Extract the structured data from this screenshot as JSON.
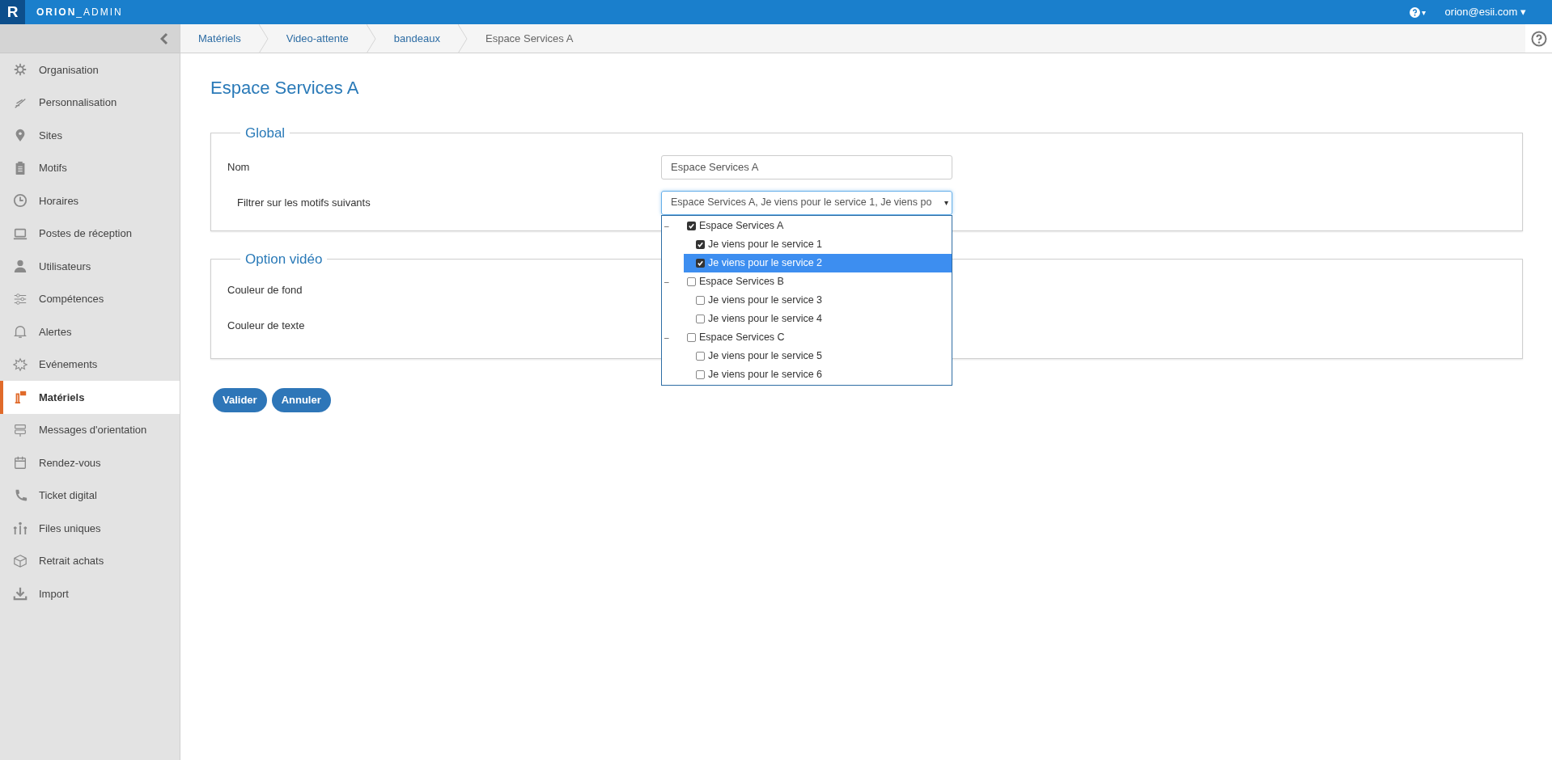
{
  "topbar": {
    "logo": "R",
    "app_name_bold": "ORION",
    "app_name_light": "_ADMIN",
    "help_caret": "▾",
    "user": "orion@esii.com",
    "user_caret": "▾"
  },
  "breadcrumb": [
    "Matériels",
    "Video-attente",
    "bandeaux",
    "Espace Services A"
  ],
  "sidebar": {
    "items": [
      {
        "label": "Organisation",
        "selected": false
      },
      {
        "label": "Personnalisation",
        "selected": false
      },
      {
        "label": "Sites",
        "selected": false
      },
      {
        "label": "Motifs",
        "selected": false
      },
      {
        "label": "Horaires",
        "selected": false
      },
      {
        "label": "Postes de réception",
        "selected": false
      },
      {
        "label": "Utilisateurs",
        "selected": false
      },
      {
        "label": "Compétences",
        "selected": false
      },
      {
        "label": "Alertes",
        "selected": false
      },
      {
        "label": "Evénements",
        "selected": false
      },
      {
        "label": "Matériels",
        "selected": true
      },
      {
        "label": "Messages d'orientation",
        "selected": false
      },
      {
        "label": "Rendez-vous",
        "selected": false
      },
      {
        "label": "Ticket digital",
        "selected": false
      },
      {
        "label": "Files uniques",
        "selected": false
      },
      {
        "label": "Retrait achats",
        "selected": false
      },
      {
        "label": "Import",
        "selected": false
      }
    ]
  },
  "page_title": "Espace Services A",
  "global": {
    "legend": "Global",
    "name_label": "Nom",
    "name_value": "Espace Services A",
    "filter_label": "Filtrer sur les motifs suivants",
    "filter_value": "Espace Services A, Je viens pour le service 1, Je viens po",
    "filter_caret": "▾",
    "tree": [
      {
        "label": "Espace Services A",
        "toggle": "–",
        "checked": true,
        "selected": false,
        "children": [
          {
            "label": "Je viens pour le service 1",
            "checked": true,
            "selected": false
          },
          {
            "label": "Je viens pour le service 2",
            "checked": true,
            "selected": true
          }
        ]
      },
      {
        "label": "Espace Services B",
        "toggle": "–",
        "checked": false,
        "selected": false,
        "children": [
          {
            "label": "Je viens pour le service 3",
            "checked": false,
            "selected": false
          },
          {
            "label": "Je viens pour le service 4",
            "checked": false,
            "selected": false
          }
        ]
      },
      {
        "label": "Espace Services C",
        "toggle": "–",
        "checked": false,
        "selected": false,
        "children": [
          {
            "label": "Je viens pour le service 5",
            "checked": false,
            "selected": false
          },
          {
            "label": "Je viens pour le service 6",
            "checked": false,
            "selected": false
          }
        ]
      }
    ]
  },
  "video": {
    "legend": "Option vidéo",
    "fields": [
      "Couleur de fond",
      "Couleur de texte"
    ]
  },
  "buttons": [
    "Valider",
    "Annuler"
  ]
}
